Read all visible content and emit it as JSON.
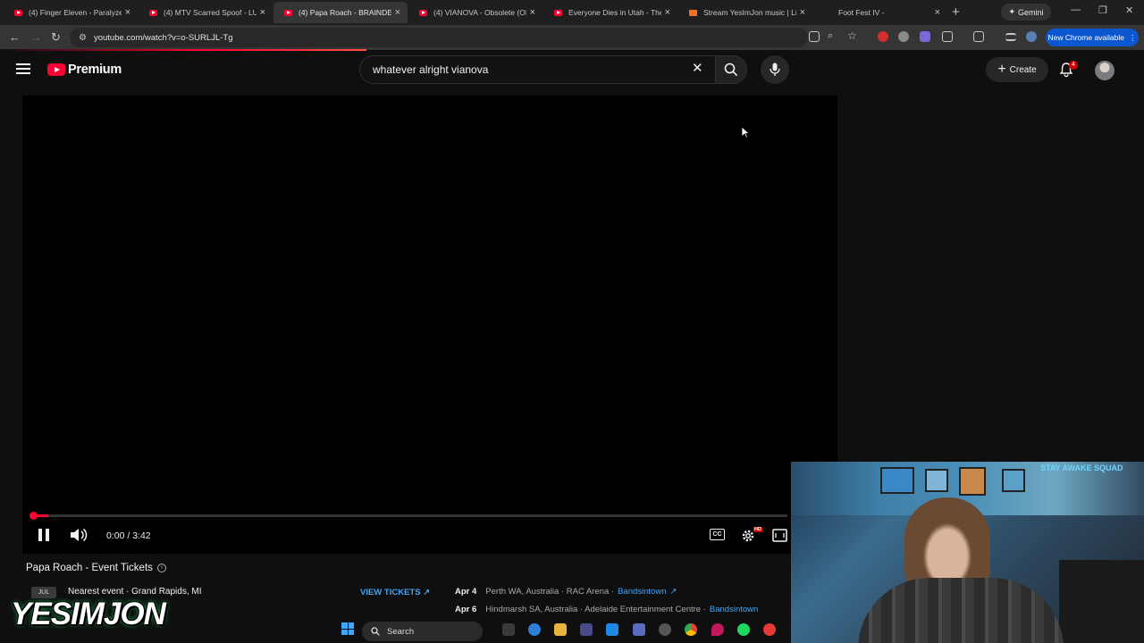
{
  "browser": {
    "tabs": [
      {
        "title": "(4) Finger Eleven - Paralyzer (",
        "favicon": "youtube",
        "active": false
      },
      {
        "title": "(4) MTV Scarred Spoof - LURI",
        "favicon": "youtube",
        "active": false
      },
      {
        "title": "(4) Papa Roach - BRAINDE",
        "favicon": "youtube",
        "active": true
      },
      {
        "title": "(4) VIANOVA - Obsolete (OFF",
        "favicon": "youtube",
        "active": false
      },
      {
        "title": "Everyone Dies in Utah - The C",
        "favicon": "youtube",
        "active": false
      },
      {
        "title": "Stream YesImJon music | Liste",
        "favicon": "soundcloud",
        "active": false
      },
      {
        "title": "Foot Fest IV -",
        "favicon": "none",
        "active": false
      }
    ],
    "gemini_label": "Gemini",
    "url": "youtube.com/watch?v=o-SURLJL-Tg",
    "update_label": "New Chrome available"
  },
  "youtube": {
    "logo_word": "Premium",
    "search_value": "whatever alright vianova",
    "create_label": "Create",
    "notification_count": "4"
  },
  "player": {
    "time": "0:00 / 3:42",
    "progress_fraction": 0.0,
    "cc_label": "CC",
    "hd_badge": "HD"
  },
  "events": {
    "title": "Papa Roach - Event Tickets",
    "month": "JUL",
    "nearest": "Nearest event · Grand Rapids, MI",
    "view_tickets": "VIEW TICKETS",
    "list": [
      {
        "date": "Apr 4",
        "place": "Perth WA, Australia · RAC Arena ·",
        "link": "Bandsintown"
      },
      {
        "date": "Apr 6",
        "place": "Hindmarsh SA, Australia · Adelaide Entertainment Centre ·",
        "link": "Bandsintown"
      }
    ]
  },
  "overlay": {
    "streamer_name": "YESIMJON",
    "webcam_sign": "STAY AWAKE SQUAD"
  },
  "taskbar": {
    "search_label": "Search"
  },
  "colors": {
    "accent_red": "#ff0033",
    "link_blue": "#3ea6ff",
    "background": "#0f0f0f"
  }
}
